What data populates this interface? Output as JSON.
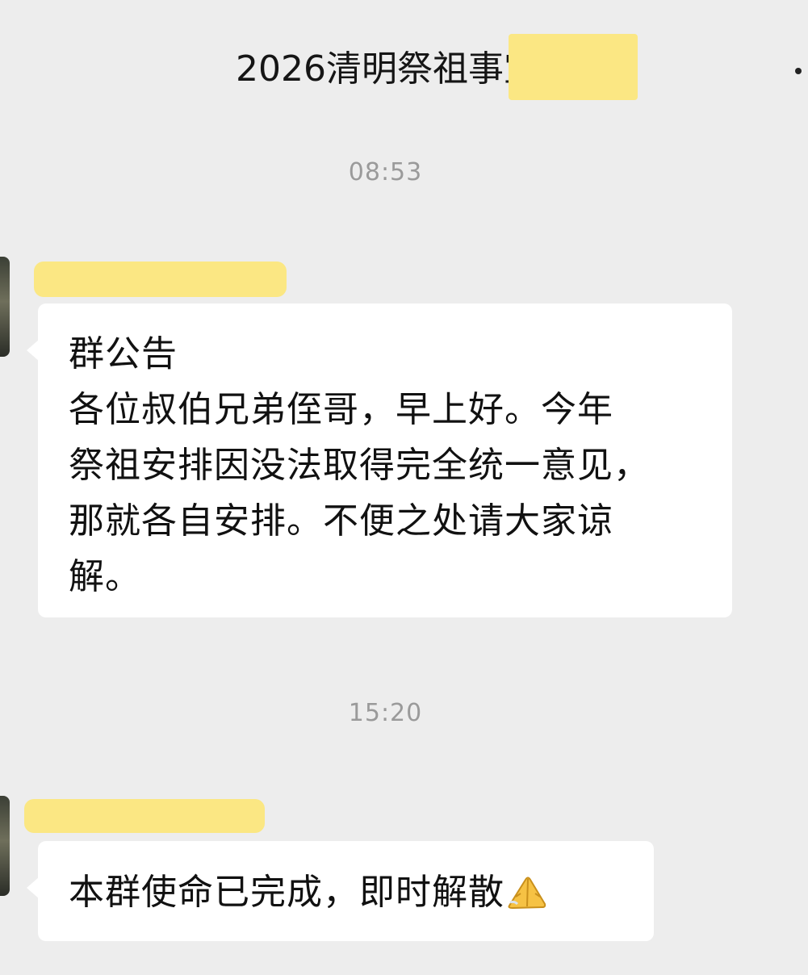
{
  "header": {
    "title": "2026清明祭祖事宜",
    "more_icon": "more-dots-icon"
  },
  "messages": [
    {
      "timestamp": "08:53",
      "sender_name_redacted": true,
      "lines": [
        "群公告",
        "各位叔伯兄弟侄哥，早上好。今年",
        "祭祖安排因没法取得完全统一意见，",
        "那就各自安排。不便之处请大家谅",
        "解。"
      ]
    },
    {
      "timestamp": "15:20",
      "sender_name_redacted": true,
      "text": "本群使命已完成，即时解散",
      "emoji": "folded-hands-icon"
    }
  ],
  "colors": {
    "background": "#ededed",
    "bubble": "#ffffff",
    "redaction": "#fbe783",
    "timestamp": "#9a9a9a"
  }
}
